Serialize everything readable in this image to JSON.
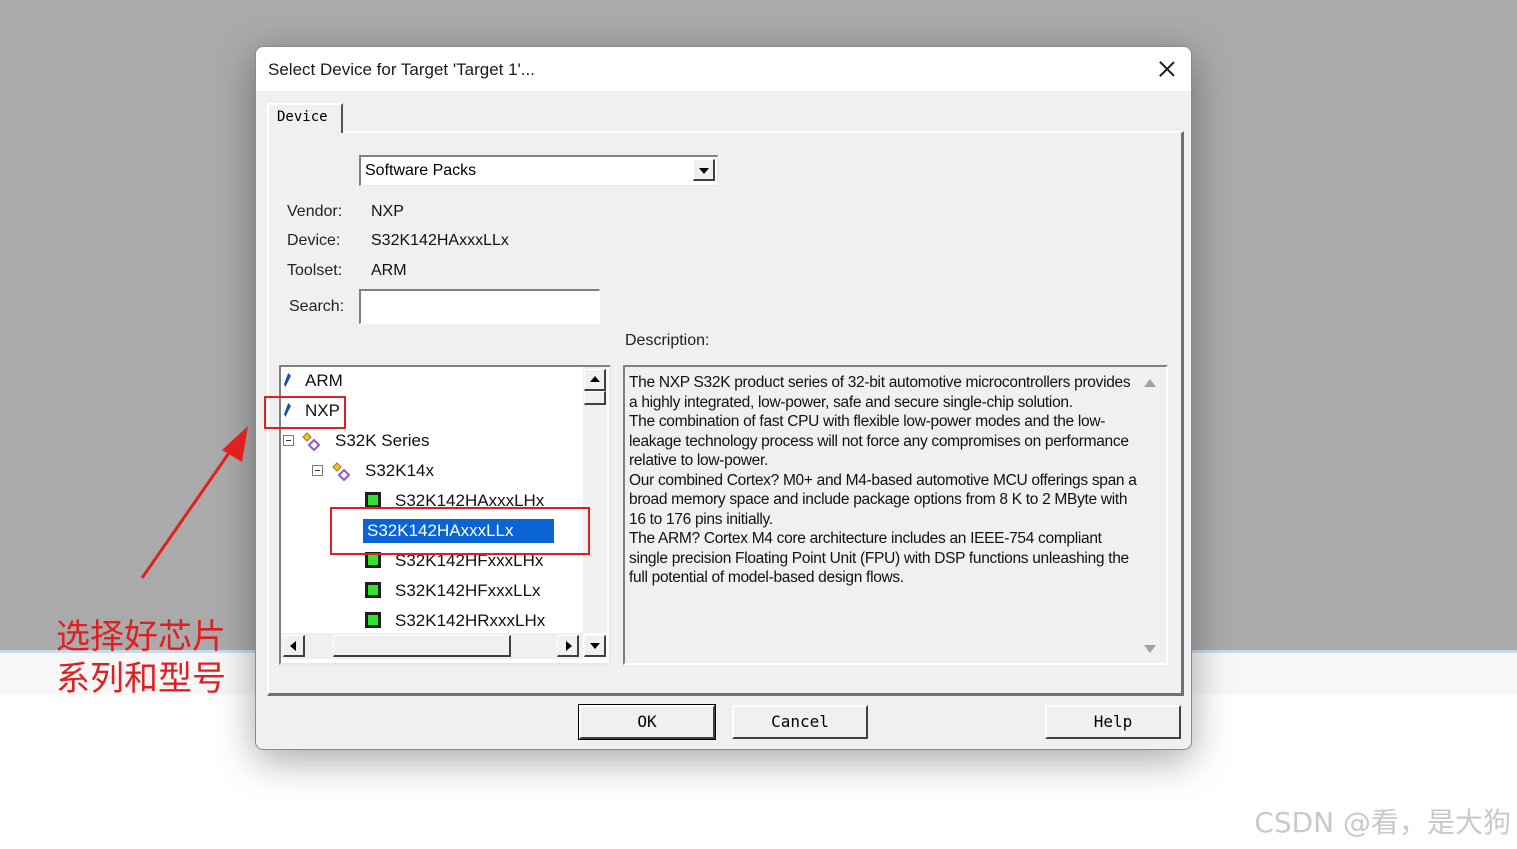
{
  "dialog": {
    "title": "Select Device for Target 'Target 1'...",
    "tab_label": "Device",
    "source_select": "Software Packs",
    "info": {
      "vendor_label": "Vendor:",
      "vendor_value": "NXP",
      "device_label": "Device:",
      "device_value": "S32K142HAxxxLLx",
      "toolset_label": "Toolset:",
      "toolset_value": "ARM",
      "search_label": "Search:",
      "search_value": ""
    },
    "description_label": "Description:",
    "tree": [
      {
        "label": "ARM"
      },
      {
        "label": "NXP"
      },
      {
        "label": "S32K Series"
      },
      {
        "label": "S32K14x"
      },
      {
        "label": "S32K142HAxxxLHx"
      },
      {
        "label": "S32K142HAxxxLLx"
      },
      {
        "label": "S32K142HFxxxLHx"
      },
      {
        "label": "S32K142HFxxxLLx"
      },
      {
        "label": "S32K142HRxxxLHx"
      }
    ],
    "description": [
      "The NXP S32K product series of 32-bit automotive microcontrollers provides a highly integrated, low-power, safe and secure single-chip solution.",
      "The combination of fast CPU with flexible low-power modes and the low-leakage technology process will not force any compromises on performance relative to low-power.",
      "Our combined Cortex? M0+ and M4-based automotive MCU offerings span a broad memory space and include package options from 8 K to 2 MByte with 16 to 176 pins initially.",
      "The ARM? Cortex M4 core architecture includes an IEEE-754 compliant single precision Floating Point Unit (FPU) with DSP functions unleashing the full potential of model-based design flows."
    ],
    "buttons": {
      "ok": "OK",
      "cancel": "Cancel",
      "help": "Help"
    }
  },
  "annotation": {
    "line1": "选择好芯片",
    "line2": "系列和型号",
    "color": "#e02020"
  },
  "watermark": "CSDN @看，是大狗"
}
